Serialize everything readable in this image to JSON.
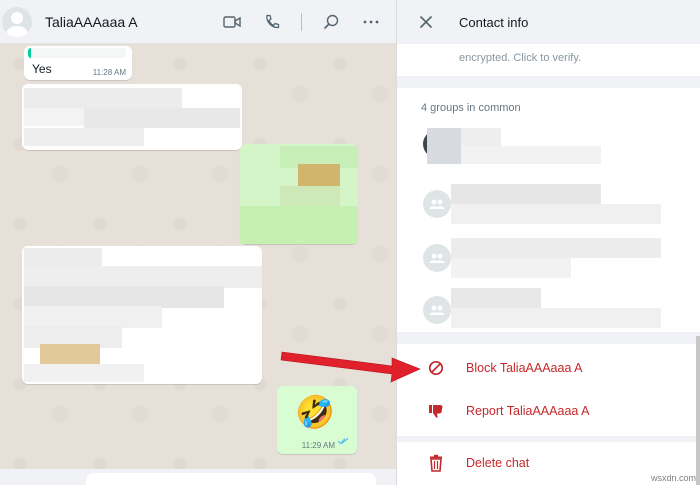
{
  "chat": {
    "contact_name": "TaliaAAAaaa A",
    "messages": [
      {
        "text": "Yes",
        "time": "11:28 AM",
        "direction": "in"
      },
      {
        "text": "",
        "time": "11:29 AM",
        "direction": "out",
        "emoji": "🤣"
      }
    ]
  },
  "header_icons": [
    "video-call-icon",
    "voice-call-icon",
    "search-icon",
    "menu-icon"
  ],
  "contact_info": {
    "title": "Contact info",
    "encryption_text": "encrypted. Click to verify.",
    "groups_label": "4 groups in common",
    "actions": [
      {
        "label": "Block TaliaAAAaaa A",
        "icon": "block-icon"
      },
      {
        "label": "Report TaliaAAAaaa A",
        "icon": "thumbs-down-icon"
      },
      {
        "label": "Delete chat",
        "icon": "trash-icon"
      }
    ]
  },
  "colors": {
    "danger": "#c4292c",
    "outgoing_bubble": "#d9fdd3",
    "annotation_arrow": "#e0202a"
  },
  "watermark": "wsxdn.com"
}
